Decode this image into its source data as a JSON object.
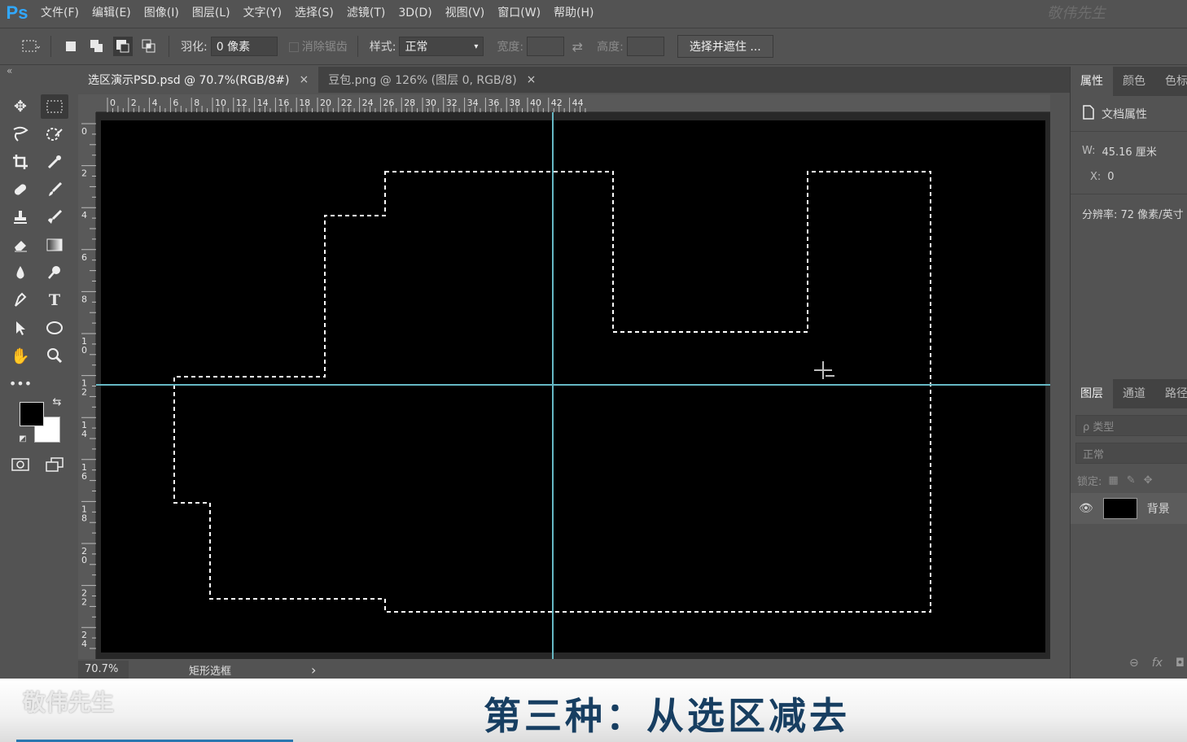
{
  "app": {
    "logo": "Ps",
    "watermark_top": "敬伟先生"
  },
  "menu": [
    "文件(F)",
    "编辑(E)",
    "图像(I)",
    "图层(L)",
    "文字(Y)",
    "选择(S)",
    "滤镜(T)",
    "3D(D)",
    "视图(V)",
    "窗口(W)",
    "帮助(H)"
  ],
  "options": {
    "feather_label": "羽化:",
    "feather_value": "0 像素",
    "antialias_label": "消除锯齿",
    "style_label": "样式:",
    "style_value": "正常",
    "width_label": "宽度:",
    "height_label": "高度:",
    "select_mask_button": "选择并遮住 ..."
  },
  "tabs": [
    {
      "label": "选区演示PSD.psd @ 70.7%(RGB/8#)",
      "close": "×",
      "active": true
    },
    {
      "label": "豆包.png @ 126% (图层 0, RGB/8)",
      "close": "×",
      "active": false
    }
  ],
  "ruler_h_labels": [
    "0",
    "2",
    "4",
    "6",
    "8",
    "10",
    "12",
    "14",
    "16",
    "18",
    "20",
    "22",
    "24",
    "26",
    "28",
    "30",
    "32",
    "34",
    "36",
    "38",
    "40",
    "42",
    "44"
  ],
  "ruler_v_labels": [
    "0",
    "2",
    "4",
    "6",
    "8",
    "10",
    "12",
    "14",
    "16",
    "18",
    "20",
    "22",
    "24"
  ],
  "status": {
    "zoom": "70.7%",
    "tool": "矩形选框",
    "arrow": "›"
  },
  "properties": {
    "tabs": [
      "属性",
      "颜色",
      "色标"
    ],
    "doc_label": "文档属性",
    "w_label": "W:",
    "w_value": "45.16 厘米",
    "x_label": "X:",
    "x_value": "0",
    "resolution": "分辨率: 72 像素/英寸"
  },
  "layers": {
    "tabs": [
      "图层",
      "通道",
      "路径"
    ],
    "filter_placeholder": "ρ 类型",
    "blend_mode": "正常",
    "lock_label": "锁定:",
    "layer_name": "背景"
  },
  "caption": {
    "text": "第三种：从选区减去",
    "watermark": "敬伟先生"
  },
  "colors": {
    "accent": "#31a8ff",
    "guide": "#66b8c4",
    "caption_text": "#173e61"
  }
}
